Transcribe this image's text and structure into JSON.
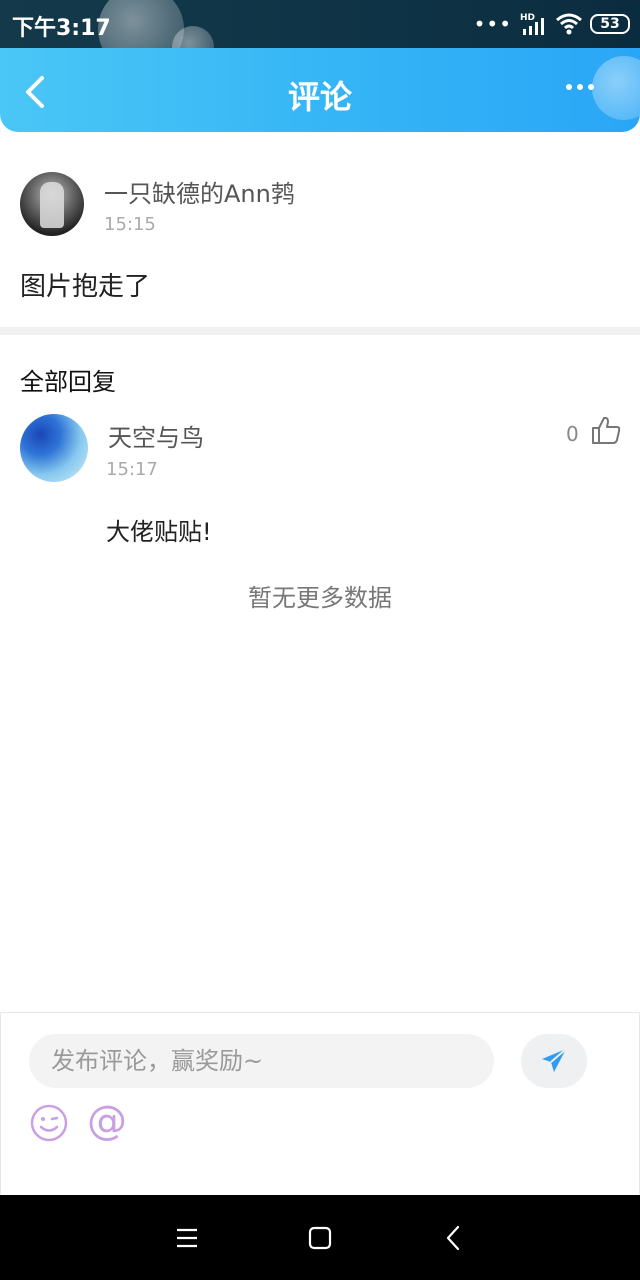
{
  "status_bar": {
    "time": "下午3:17",
    "network": "HD",
    "battery": "53"
  },
  "header": {
    "title": "评论",
    "back_icon": "back-arrow-icon",
    "more_icon": "more-dots-icon"
  },
  "post": {
    "author": "一只缺德的Ann鹁",
    "time": "15:15",
    "content": "图片抱走了"
  },
  "replies": {
    "section_title": "全部回复",
    "items": [
      {
        "name": "天空与鸟",
        "time": "15:17",
        "likes": "0",
        "content": "大佬贴贴!"
      }
    ],
    "no_more": "暂无更多数据"
  },
  "composer": {
    "placeholder": "发布评论，赢奖励~",
    "send_icon": "send-plane-icon",
    "emoji_icon": "emoji-icon",
    "mention_symbol": "@"
  },
  "colors": {
    "header_start": "#4ac7f6",
    "header_end": "#2aa6f6",
    "send_icon": "#2e9cf2",
    "tool_icons": "#c9a0e6"
  }
}
